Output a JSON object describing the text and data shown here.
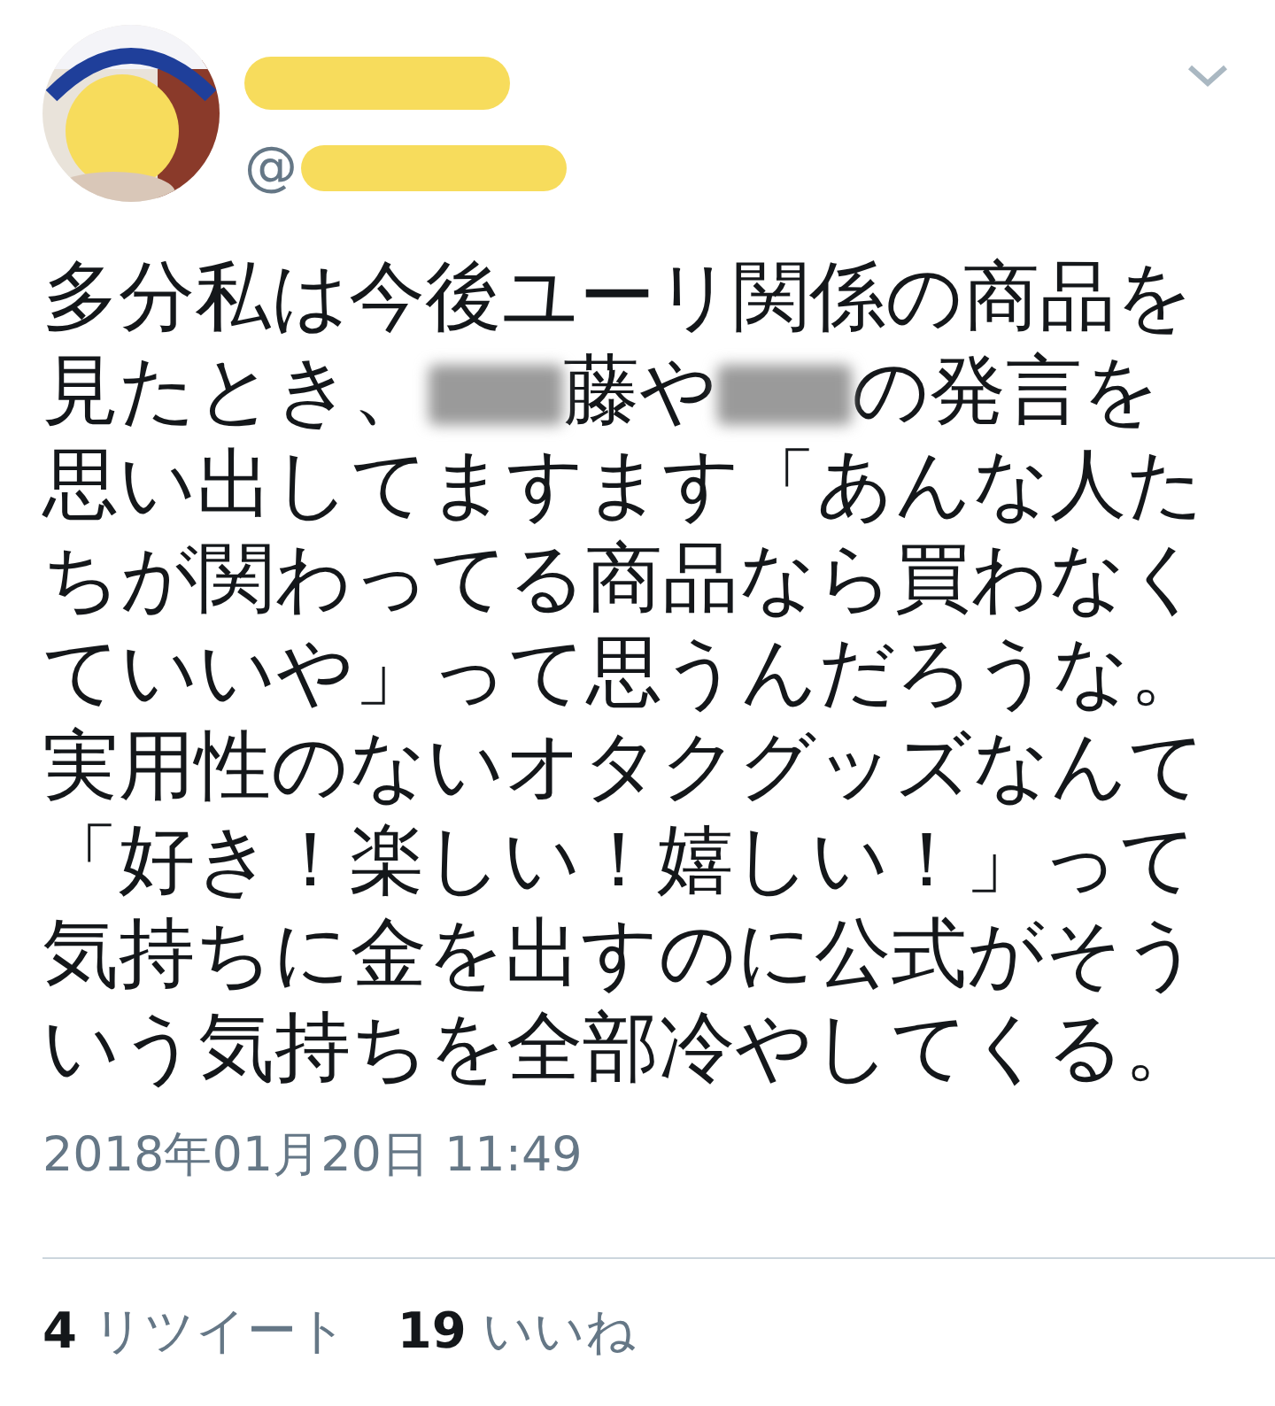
{
  "tweet": {
    "handle": "@",
    "body": [
      {
        "kind": "text",
        "text": "多分私は今後ユーリ関係の商品を見たとき、"
      },
      {
        "kind": "redacted"
      },
      {
        "kind": "text",
        "text": "藤や"
      },
      {
        "kind": "redacted"
      },
      {
        "kind": "text",
        "text": "の発言を思い出してますます「あんな人たちが関わってる商品なら買わなくていいや」って思うんだろうな。実用性のないオタクグッズなんて「好き！楽しい！嬉しい！」って気持ちに金を出すのに公式がそういう気持ちを全部冷やしてくる。"
      }
    ],
    "timestamp": "2018年01月20日 11:49",
    "stats": [
      {
        "count": "4",
        "label": "リツイート"
      },
      {
        "count": "19",
        "label": "いいね"
      }
    ]
  }
}
